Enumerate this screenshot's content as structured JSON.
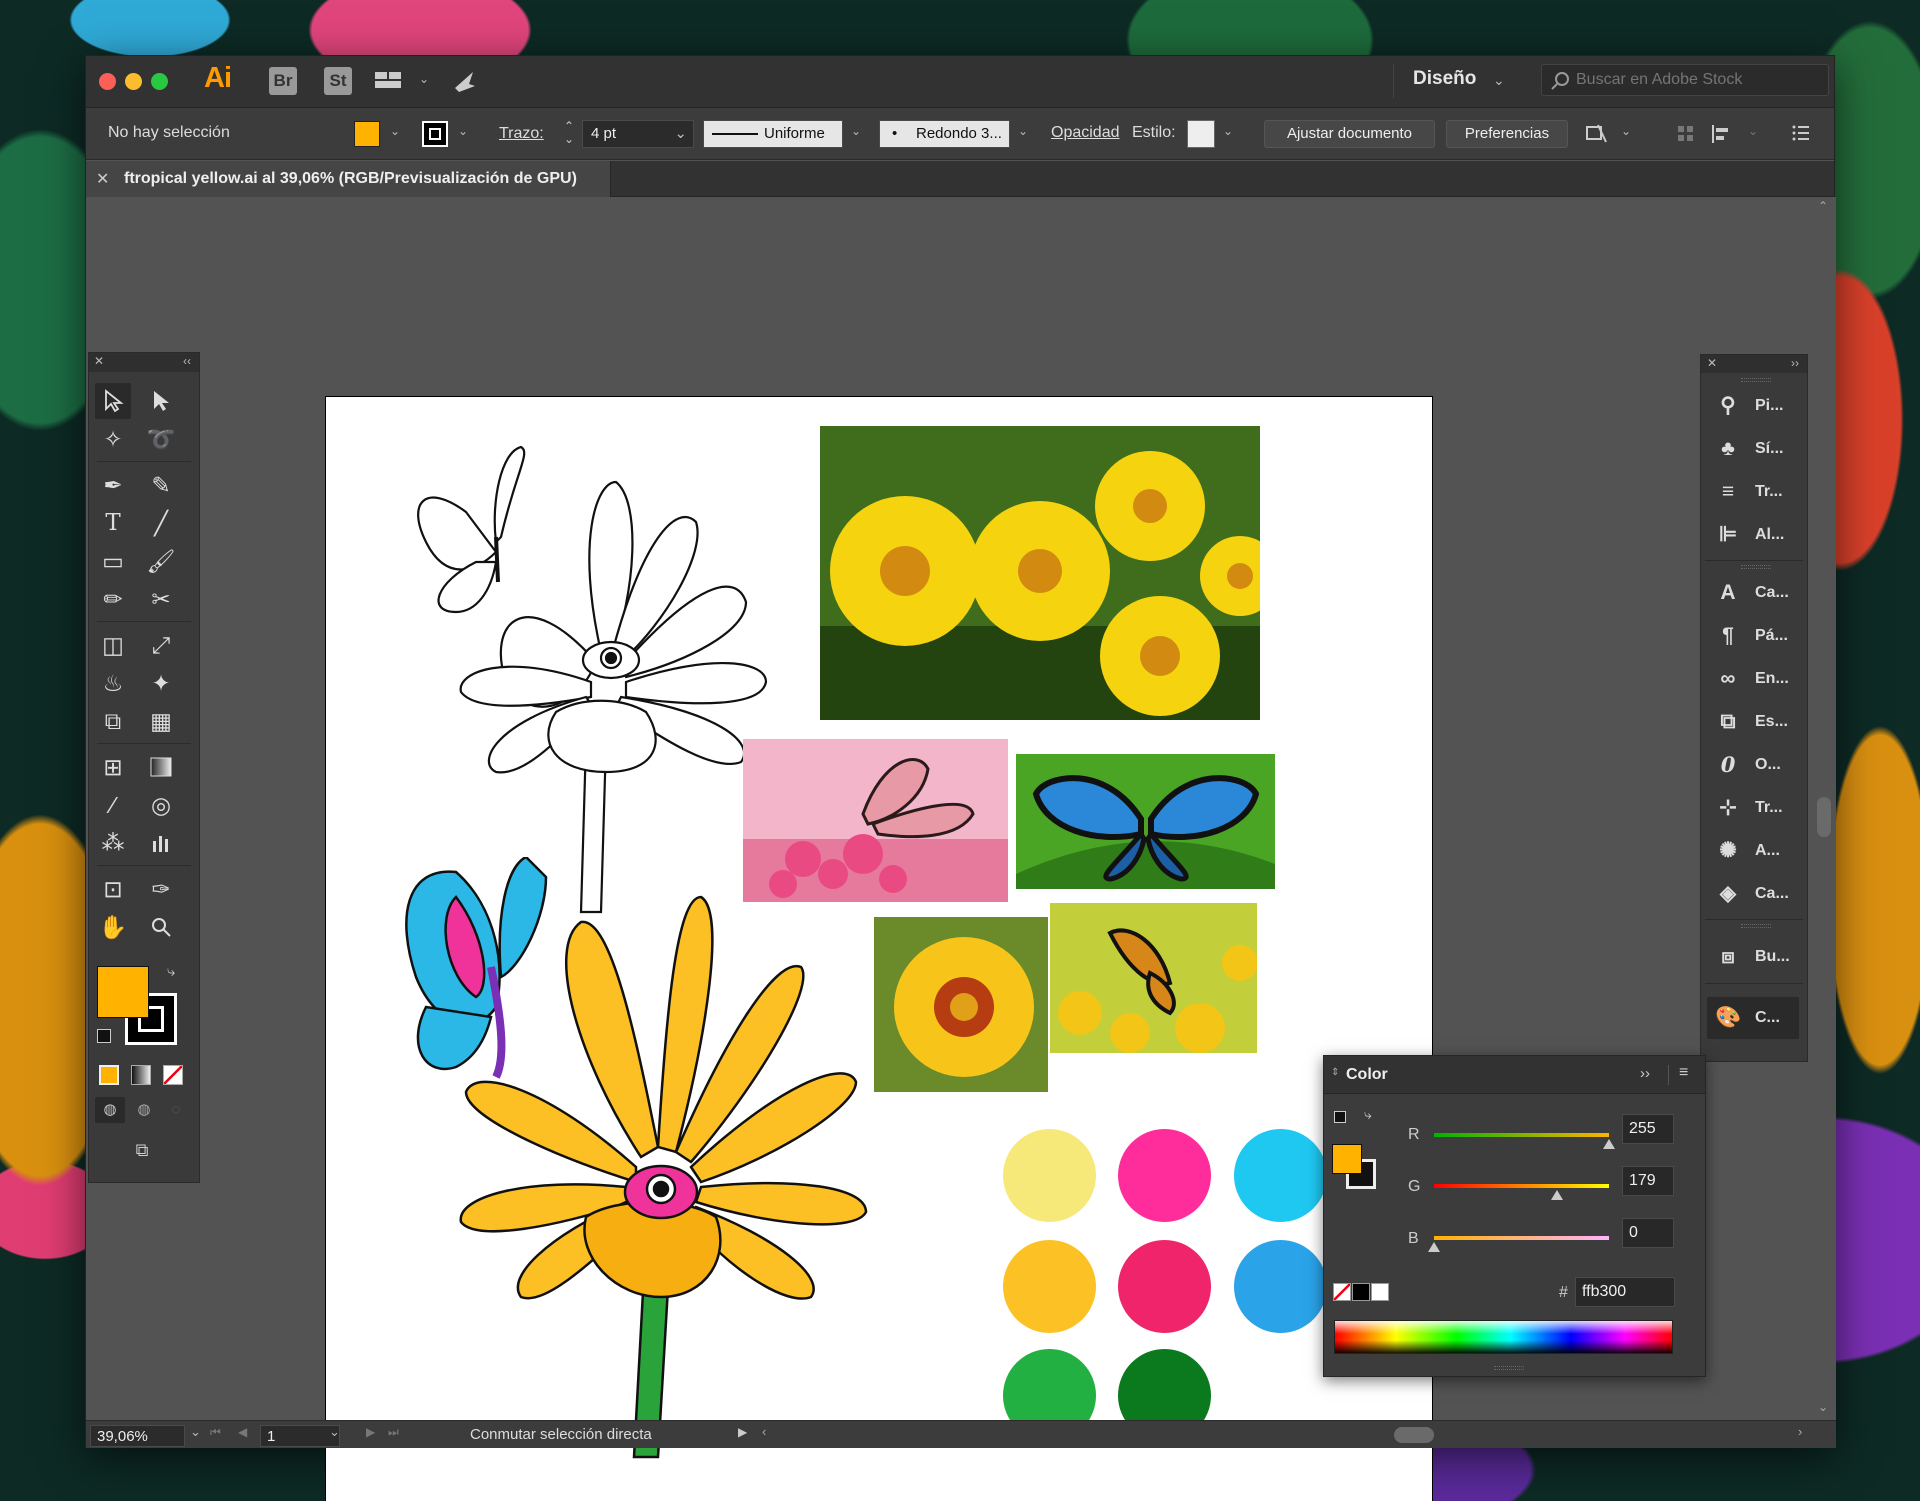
{
  "app": {
    "name": "Ai",
    "bridge": "Br",
    "stock": "St"
  },
  "workspace": {
    "label": "Diseño"
  },
  "search": {
    "placeholder": "Buscar en Adobe Stock"
  },
  "control_bar": {
    "selection": "No hay selección",
    "stroke_label": "Trazo:",
    "stroke_weight": "4 pt",
    "profile": "Uniforme",
    "brush": "Redondo 3...",
    "opacity": "Opacidad",
    "style": "Estilo:",
    "adjust_document": "Ajustar documento",
    "preferences": "Preferencias"
  },
  "document_tab": {
    "title": "ftropical yellow.ai al 39,06% (RGB/Previsualización de GPU)"
  },
  "colors": {
    "fill": "#ffb300",
    "stroke": "#000000",
    "accent": "#ff9a00"
  },
  "right_panel": {
    "items": [
      {
        "label": "Pi...",
        "icon": "puppet-icon"
      },
      {
        "label": "Sí...",
        "icon": "symbols-icon"
      },
      {
        "label": "Tr...",
        "icon": "stroke-icon"
      },
      {
        "label": "Al...",
        "icon": "align-icon"
      },
      {
        "label": "Ca...",
        "icon": "character-icon"
      },
      {
        "label": "Pá...",
        "icon": "paragraph-icon"
      },
      {
        "label": "En...",
        "icon": "links-icon"
      },
      {
        "label": "Es...",
        "icon": "artboards-icon"
      },
      {
        "label": "O...",
        "icon": "opentype-icon"
      },
      {
        "label": "Tr...",
        "icon": "transform-icon"
      },
      {
        "label": "A...",
        "icon": "appearance-icon"
      },
      {
        "label": "Ca...",
        "icon": "layers-icon"
      },
      {
        "label": "Bu...",
        "icon": "pathfinder-icon"
      },
      {
        "label": "C...",
        "icon": "color-palette-icon"
      }
    ]
  },
  "color_panel": {
    "title": "Color",
    "channels": [
      {
        "name": "R",
        "value": "255"
      },
      {
        "name": "G",
        "value": "179"
      },
      {
        "name": "B",
        "value": "0"
      }
    ],
    "hex_label": "#",
    "hex": "ffb300"
  },
  "swatches": [
    "#f7e87a",
    "#ff2c9b",
    "#1ec8f0",
    "#fcc124",
    "#f0246a",
    "#2aa3e8",
    "#22b042",
    "#0b7a1e"
  ],
  "status": {
    "zoom": "39,06%",
    "page": "1",
    "message": "Conmutar selección directa"
  }
}
